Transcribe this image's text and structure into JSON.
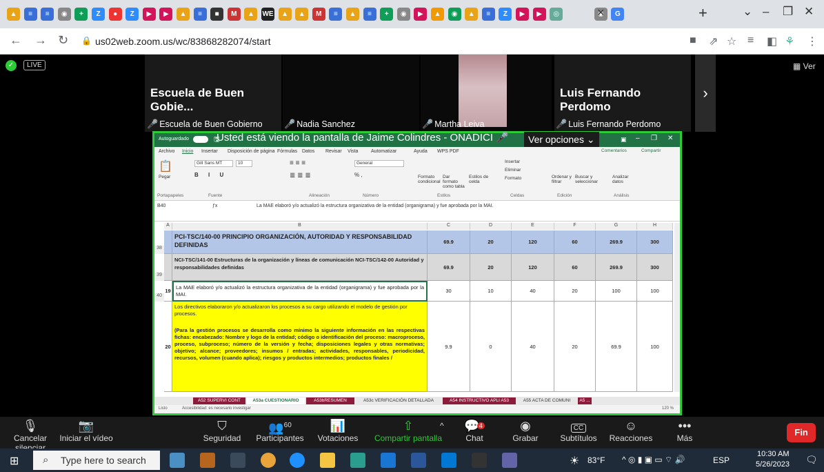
{
  "browser": {
    "tab_letters": [
      "▲",
      "≡",
      "≡",
      "◉",
      "+",
      "Z",
      "●",
      "Z",
      "▶",
      "▶",
      "▲",
      "≡",
      "■",
      "M",
      "▲",
      "WE",
      "▲",
      "▲",
      "M",
      "≡",
      "▲",
      "≡",
      "+",
      "◉",
      "▶",
      "▲",
      "◉",
      "▲",
      "≡",
      "Z",
      "▶",
      "▶",
      "◎",
      "◉",
      "G"
    ],
    "url": "us02web.zoom.us/wc/83868282074/start",
    "new_tab": "+",
    "close_tab": "×"
  },
  "meeting": {
    "live_badge": "LIVE",
    "view_label": "Ver",
    "tile_big_names": [
      "Escuela de Buen Gobie...",
      "Luis Fernando Perdomo"
    ],
    "participants": [
      "Escuela de Buen Gobierno",
      "Nadia Sanchez",
      "Martha Leiva",
      "Luis Fernando Perdomo"
    ],
    "share_banner": "Usted está viendo la pantalla de Jaime Colindres - ONADICI",
    "ver_opciones": "Ver opciones"
  },
  "excel": {
    "autosave": "Autoguardado",
    "ribbon_tabs": [
      "Archivo",
      "Inicio",
      "Insertar",
      "Disposición de página",
      "Fórmulas",
      "Datos",
      "Revisar",
      "Vista",
      "Automatizar",
      "Ayuda",
      "WPS PDF"
    ],
    "comments": "Comentarios",
    "share": "Compartir",
    "font": "Gill Sans MT",
    "font_size": "10",
    "number_format": "General",
    "group_labels": [
      "Portapapeles",
      "Fuente",
      "Alineación",
      "Número",
      "Estilos",
      "Celdas",
      "Edición",
      "Análisis"
    ],
    "ribbon_items": [
      "Pegar",
      "Formato condicional",
      "Dar formato como tabla",
      "Estilos de celda",
      "Insertar",
      "Eliminar",
      "Formato",
      "Ordenar y filtrar",
      "Buscar y seleccionar",
      "Analizar datos"
    ],
    "cell_ref": "B40",
    "formula": "La MAE elaboró y/o actualizó la estructura organizativa de la entidad (organigrama) y fue aprobada por la MAI.",
    "columns": [
      "A",
      "B",
      "C",
      "D",
      "E",
      "F",
      "G",
      "H"
    ],
    "rows": [
      {
        "num": "38",
        "a": "",
        "b": "PCI-TSC/140-00 PRINCIPIO ORGANIZACIÓN, AUTORIDAD Y RESPONSABILIDAD DEFINIDAS",
        "c": "69.9",
        "d": "20",
        "e": "120",
        "f": "60",
        "g": "269.9",
        "h": "300"
      },
      {
        "num": "39",
        "a": "",
        "b": "NCI-TSC/141-00 Estructuras de la organización y líneas de comunicación NCI-TSC/142-00 Autoridad y responsabilidades definidas",
        "c": "69.9",
        "d": "20",
        "e": "120",
        "f": "60",
        "g": "269.9",
        "h": "300"
      },
      {
        "num": "40",
        "a": "19",
        "b": "La MAE elaboró y/o actualizó la estructura organizativa de la entidad (organigrama) y fue aprobada por la MAI.",
        "c": "30",
        "d": "10",
        "e": "40",
        "f": "20",
        "g": "100",
        "h": "100"
      },
      {
        "num": "",
        "a": "20",
        "b1": "Los directivos elaboraron y/o actualizaron los procesos a su cargo utilizando el modelo de gestión por procesos.",
        "b2": "(Para la gestión procesos se desarrolla como mínimo la siguiente información en las respectivas fichas: encabezado: Nombre y logo de la entidad; código o identificación del proceso: macroproceso, proceso, subproceso; número de la versión y fecha; disposiciones legales y otras normativas; objetivo; alcance; proveedores; insumos / entradas; actividades, responsables, periodicidad, recursos, volumen (cuando aplica); riesgos y productos intermedios; productos finales /",
        "c": "9.9",
        "d": "0",
        "e": "40",
        "f": "20",
        "g": "69.9",
        "h": "100"
      }
    ],
    "sheet_tabs": [
      "A52 SUPERVI CONT",
      "A53a CUESTIONARIO",
      "A53bRESUMEN",
      "A53c VERIFICACIÓN DETALLADA",
      "A54 INSTRUCTIVO APLI A53",
      "A55 ACTA DE COMUNI",
      "A5 ..."
    ],
    "status_left": "Listo",
    "status_access": "Accesibilidad: es necesario investigar",
    "zoom_pct": "120 %"
  },
  "toolbar": {
    "mute": "Cancelar silenciar",
    "video": "Iniciar el vídeo",
    "security": "Seguridad",
    "participants": "Participantes",
    "participants_count": "60",
    "polls": "Votaciones",
    "share": "Compartir pantalla",
    "chat": "Chat",
    "chat_badge": "4",
    "record": "Grabar",
    "subtitles": "Subtítulos",
    "cc": "CC",
    "reactions": "Reacciones",
    "more": "Más",
    "end": "Fin"
  },
  "taskbar": {
    "search_placeholder": "Type here to search",
    "temp": "83°F",
    "lang": "ESP",
    "time": "10:30 AM",
    "date": "5/26/2023"
  }
}
